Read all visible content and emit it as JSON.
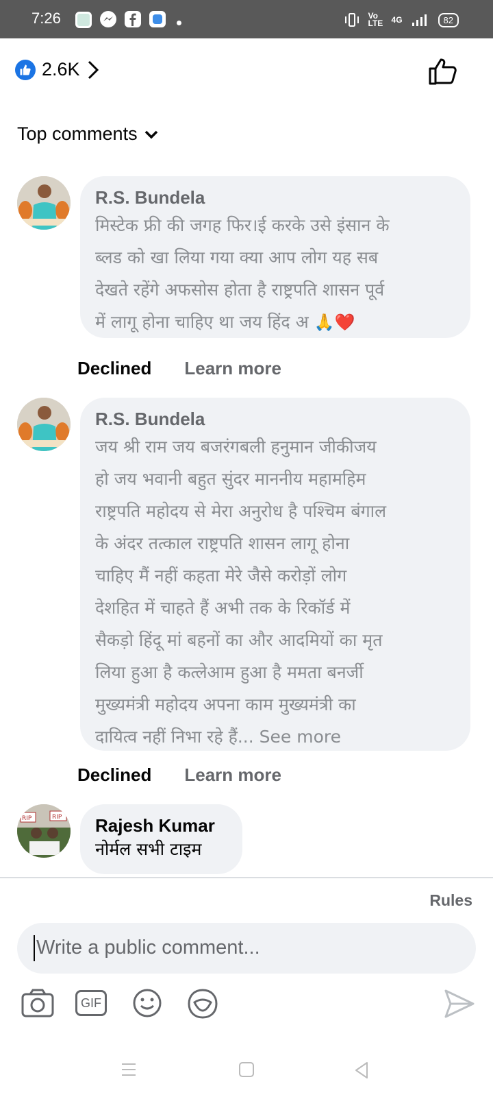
{
  "status_bar": {
    "time": "7:26",
    "network_label": "Vo LTE",
    "signal_label": "4G",
    "battery": "82"
  },
  "reactions": {
    "count": "2.6K",
    "like_color": "#1b74e4"
  },
  "sort": {
    "label": "Top comments"
  },
  "comments": [
    {
      "author": "R.S. Bundela",
      "lines": [
        "मिस्टेक फ्री की जगह फिर।ई करके उसे इंसान के",
        "ब्लड को खा लिया गया क्या आप लोग यह सब",
        "देखते रहेंगे अफसोस होता है राष्ट्रपति शासन पूर्व",
        "में लागू होना चाहिए था जय हिंद अ"
      ],
      "emoji": "🙏❤️",
      "action_declined": "Declined",
      "action_learn": "Learn more"
    },
    {
      "author": "R.S. Bundela",
      "lines": [
        "जय श्री राम जय बजरंगबली हनुमान जीकीजय",
        "हो जय भवानी बहुत सुंदर माननीय महामहिम",
        "राष्ट्रपति महोदय से मेरा अनुरोध है पश्चिम बंगाल",
        "के अंदर तत्काल राष्ट्रपति शासन लागू होना",
        "चाहिए मैं नहीं कहता मेरे जैसे करोड़ों लोग",
        "देशहित में चाहते हैं अभी तक के रिकॉर्ड में",
        "सैकड़ो हिंदू मां बहनों का और आदमियों का मृत",
        "लिया हुआ है कत्लेआम हुआ है ममता बनर्जी",
        "मुख्यमंत्री महोदय अपना काम मुख्यमंत्री का",
        "दायित्व नहीं निभा रहे हैं..."
      ],
      "see_more": "See more",
      "action_declined": "Declined",
      "action_learn": "Learn more"
    },
    {
      "author": "Rajesh Kumar",
      "text": "नोर्मल सभी टाइम",
      "avatar_badges": [
        "RIP",
        "RIP"
      ]
    }
  ],
  "composer": {
    "rules": "Rules",
    "placeholder": "Write a public comment..."
  },
  "toolbar": {
    "gif_label": "GIF"
  }
}
